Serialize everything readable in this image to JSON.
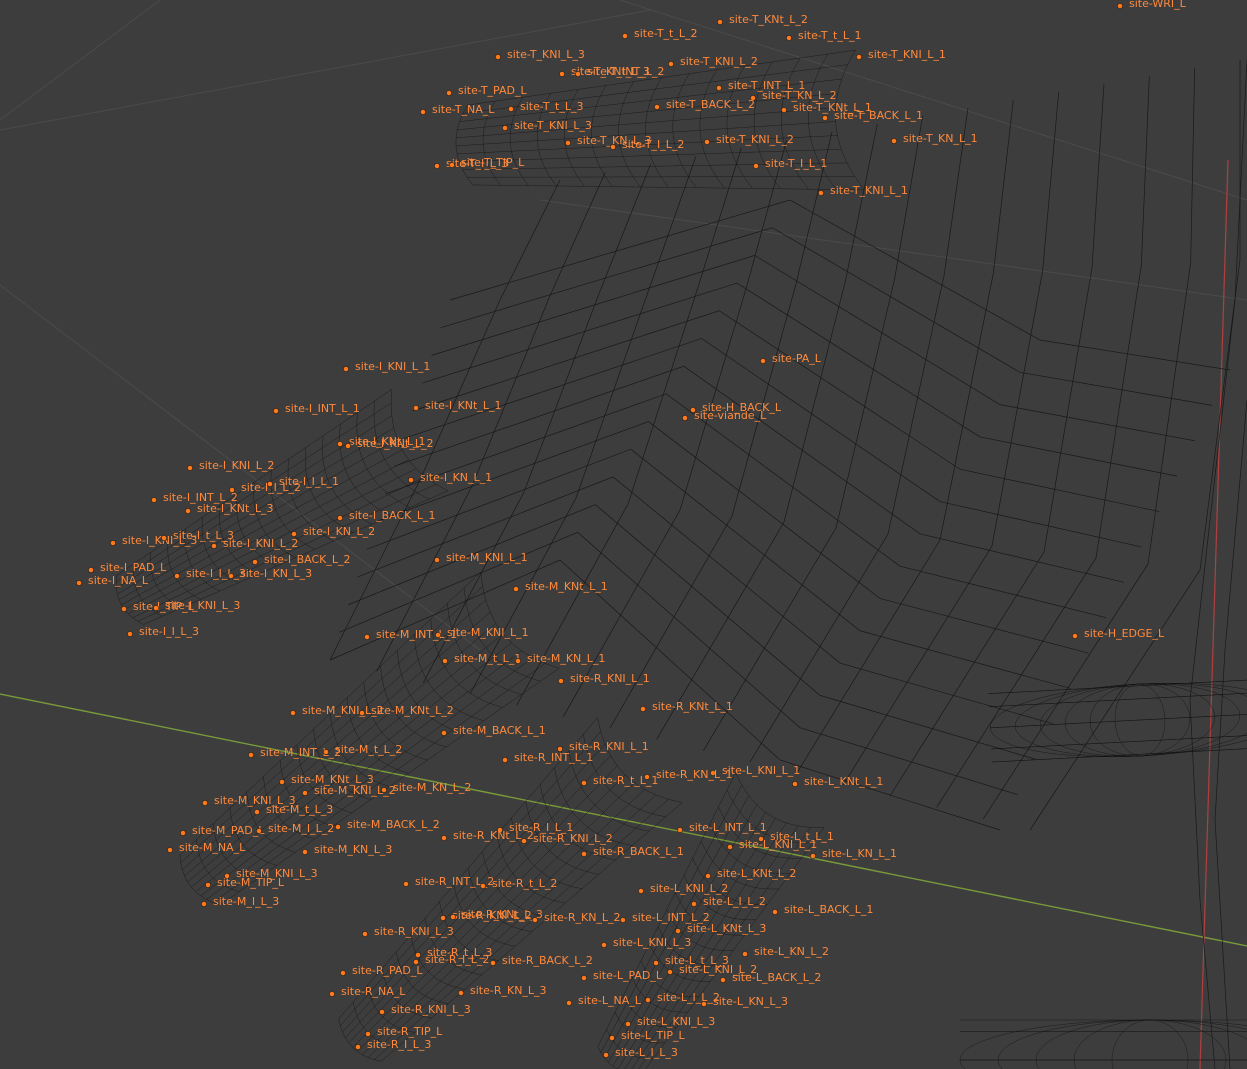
{
  "viewport": {
    "background": "#3d3d3d",
    "site_color": "#ff8a3d",
    "axis_x_color": "#7a9a3a",
    "axis_y_color": "#b04040"
  },
  "sites": [
    {
      "name": "site-WRI_L"
    },
    {
      "name": "site-T_KNt_L_2"
    },
    {
      "name": "site-T_t_L_2"
    },
    {
      "name": "site-T_t_L_1"
    },
    {
      "name": "site-T_KNI_L_3"
    },
    {
      "name": "site-T_KNI_L_2"
    },
    {
      "name": "site-T_KNI_L_1"
    },
    {
      "name": "site-T_KNt_L_3"
    },
    {
      "name": "site-T_INT_L_2"
    },
    {
      "name": "site-T_PAD_L"
    },
    {
      "name": "site-T_INT_L_1"
    },
    {
      "name": "site-T_KN_L_2"
    },
    {
      "name": "site-T_NA_L"
    },
    {
      "name": "site-T_t_L_3"
    },
    {
      "name": "site-T_BACK_L_2"
    },
    {
      "name": "site-T_KNt_L_1"
    },
    {
      "name": "site-T_BACK_L_1"
    },
    {
      "name": "site-T_KNI_L_3"
    },
    {
      "name": "site-T_KN_L_3"
    },
    {
      "name": "site-T_I_L_2"
    },
    {
      "name": "site-T_KNI_L_2"
    },
    {
      "name": "site-T_KN_L_1"
    },
    {
      "name": "site-T_I_L_3"
    },
    {
      "name": "site-T_TIP_L"
    },
    {
      "name": "site-T_I_L_1"
    },
    {
      "name": "site-T_KNI_L_1"
    },
    {
      "name": "site-PA_L"
    },
    {
      "name": "site-I_KNI_L_1"
    },
    {
      "name": "site-H_BACK_L"
    },
    {
      "name": "site-I_INT_L_1"
    },
    {
      "name": "site-I_KNt_L_1"
    },
    {
      "name": "site-viande_L"
    },
    {
      "name": "site-I_KNt_L_1"
    },
    {
      "name": "site-I_KNt_L_2"
    },
    {
      "name": "site-I_KNI_L_2"
    },
    {
      "name": "site-I_I_L_1"
    },
    {
      "name": "site-I_I_L_2"
    },
    {
      "name": "site-I_KN_L_1"
    },
    {
      "name": "site-I_INT_L_2"
    },
    {
      "name": "site-I_KNt_L_3"
    },
    {
      "name": "site-I_BACK_L_1"
    },
    {
      "name": "site-I_KN_L_2"
    },
    {
      "name": "site-I_KNI_L_3"
    },
    {
      "name": "site-I_t_L_3"
    },
    {
      "name": "site-I_KNI_L_2"
    },
    {
      "name": "site-M_KNI_L_1"
    },
    {
      "name": "site-I_BACK_L_2"
    },
    {
      "name": "site-I_PAD_L"
    },
    {
      "name": "site-I_I_L_3"
    },
    {
      "name": "site-I_KN_L_3"
    },
    {
      "name": "site-I_NA_L"
    },
    {
      "name": "site-M_KNt_L_1"
    },
    {
      "name": "site-I_TIP_L"
    },
    {
      "name": "site-I_KNI_L_3"
    },
    {
      "name": "site-I_I_L_3"
    },
    {
      "name": "site-H_EDGE_L"
    },
    {
      "name": "site-M_INT_L_1"
    },
    {
      "name": "site-M_KNI_L_1"
    },
    {
      "name": "site-M_t_L_1"
    },
    {
      "name": "site-M_KN_L_1"
    },
    {
      "name": "site-R_KNI_L_1"
    },
    {
      "name": "site-R_KNt_L_1"
    },
    {
      "name": "site-M_KNI_L_2"
    },
    {
      "name": "site-M_KNt_L_2"
    },
    {
      "name": "site-M_BACK_L_1"
    },
    {
      "name": "site-R_KNI_L_1"
    },
    {
      "name": "site-M_INT_L_2"
    },
    {
      "name": "site-M_t_L_2"
    },
    {
      "name": "site-R_INT_L_1"
    },
    {
      "name": "site-L_KNI_L_1"
    },
    {
      "name": "site-R_KN_L_1"
    },
    {
      "name": "site-M_KNt_L_3"
    },
    {
      "name": "site-L_KNt_L_1"
    },
    {
      "name": "site-R_t_L_1"
    },
    {
      "name": "site-M_KNI_L_2"
    },
    {
      "name": "site-M_KN_L_2"
    },
    {
      "name": "site-M_KNI_L_3"
    },
    {
      "name": "site-M_t_L_3"
    },
    {
      "name": "site-R_I_L_1"
    },
    {
      "name": "site-L_INT_L_1"
    },
    {
      "name": "site-M_BACK_L_2"
    },
    {
      "name": "site-L_t_L_1"
    },
    {
      "name": "site-M_PAD_L"
    },
    {
      "name": "site-M_I_L_2"
    },
    {
      "name": "site-R_KNt_L_2"
    },
    {
      "name": "site-R_KNI_L_2"
    },
    {
      "name": "site-L_KNI_L_1"
    },
    {
      "name": "site-M_NA_L"
    },
    {
      "name": "site-M_KN_L_3"
    },
    {
      "name": "site-R_BACK_L_1"
    },
    {
      "name": "site-L_KN_L_1"
    },
    {
      "name": "site-M_KNI_L_3"
    },
    {
      "name": "site-L_KNt_L_2"
    },
    {
      "name": "site-M_TIP_L"
    },
    {
      "name": "site-R_INT_L_2"
    },
    {
      "name": "site-R_t_L_2"
    },
    {
      "name": "site-L_KNI_L_2"
    },
    {
      "name": "site-L_BACK_L_1"
    },
    {
      "name": "site-M_I_L_3"
    },
    {
      "name": "site-L_I_L_2"
    },
    {
      "name": "site-R_KNI_L_2"
    },
    {
      "name": "site-R_KNt_L_3"
    },
    {
      "name": "site-R_KN_L_2"
    },
    {
      "name": "site-L_INT_L_2"
    },
    {
      "name": "site-R_KNI_L_3"
    },
    {
      "name": "site-L_KNt_L_3"
    },
    {
      "name": "site-L_KNI_L_3"
    },
    {
      "name": "site-L_KN_L_2"
    },
    {
      "name": "site-R_t_L_3"
    },
    {
      "name": "site-R_I_L_2"
    },
    {
      "name": "site-R_BACK_L_2"
    },
    {
      "name": "site-L_t_L_3"
    },
    {
      "name": "site-L_KNI_L_2"
    },
    {
      "name": "site-R_PAD_L"
    },
    {
      "name": "site-L_PAD_L"
    },
    {
      "name": "site-L_BACK_L_2"
    },
    {
      "name": "site-R_NA_L"
    },
    {
      "name": "site-R_KN_L_3"
    },
    {
      "name": "site-L_NA_L"
    },
    {
      "name": "site-L_I_L_2"
    },
    {
      "name": "site-L_KN_L_3"
    },
    {
      "name": "site-R_KNI_L_3"
    },
    {
      "name": "site-L_KNI_L_3"
    },
    {
      "name": "site-R_TIP_L"
    },
    {
      "name": "site-L_TIP_L"
    },
    {
      "name": "site-R_I_L_3"
    },
    {
      "name": "site-L_I_L_3"
    }
  ]
}
